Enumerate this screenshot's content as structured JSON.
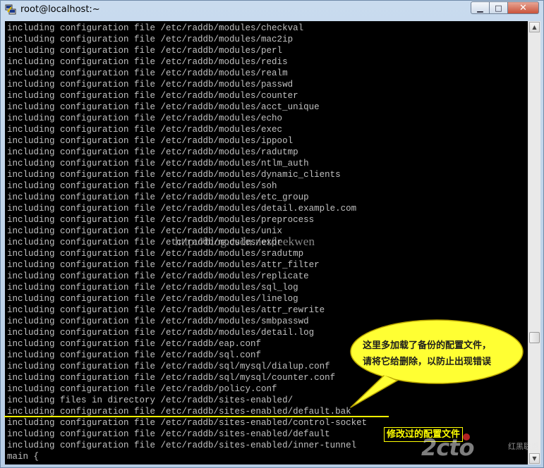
{
  "window": {
    "title": "root@localhost:~",
    "minimize_symbol": "▁",
    "maximize_symbol": "□",
    "close_symbol": "✕"
  },
  "terminal": {
    "lines": [
      "including configuration file /etc/raddb/modules/checkval",
      "including configuration file /etc/raddb/modules/mac2ip",
      "including configuration file /etc/raddb/modules/perl",
      "including configuration file /etc/raddb/modules/redis",
      "including configuration file /etc/raddb/modules/realm",
      "including configuration file /etc/raddb/modules/passwd",
      "including configuration file /etc/raddb/modules/counter",
      "including configuration file /etc/raddb/modules/acct_unique",
      "including configuration file /etc/raddb/modules/echo",
      "including configuration file /etc/raddb/modules/exec",
      "including configuration file /etc/raddb/modules/ippool",
      "including configuration file /etc/raddb/modules/radutmp",
      "including configuration file /etc/raddb/modules/ntlm_auth",
      "including configuration file /etc/raddb/modules/dynamic_clients",
      "including configuration file /etc/raddb/modules/soh",
      "including configuration file /etc/raddb/modules/etc_group",
      "including configuration file /etc/raddb/modules/detail.example.com",
      "including configuration file /etc/raddb/modules/preprocess",
      "including configuration file /etc/raddb/modules/unix",
      "including configuration file /etc/raddb/modules/expr",
      "including configuration file /etc/raddb/modules/sradutmp",
      "including configuration file /etc/raddb/modules/attr_filter",
      "including configuration file /etc/raddb/modules/replicate",
      "including configuration file /etc/raddb/modules/sql_log",
      "including configuration file /etc/raddb/modules/linelog",
      "including configuration file /etc/raddb/modules/attr_rewrite",
      "including configuration file /etc/raddb/modules/smbpasswd",
      "including configuration file /etc/raddb/modules/detail.log",
      "including configuration file /etc/raddb/eap.conf",
      "including configuration file /etc/raddb/sql.conf",
      "including configuration file /etc/raddb/sql/mysql/dialup.conf",
      "including configuration file /etc/raddb/sql/mysql/counter.conf",
      "including configuration file /etc/raddb/policy.conf",
      "including files in directory /etc/raddb/sites-enabled/",
      "including configuration file /etc/raddb/sites-enabled/default.bak",
      "including configuration file /etc/raddb/sites-enabled/control-socket",
      "including configuration file /etc/raddb/sites-enabled/default",
      "including configuration file /etc/raddb/sites-enabled/inner-tunnel",
      "main {"
    ]
  },
  "annotations": {
    "watermark": "http://blog.csdn.net/leekwen",
    "callout_line1": "这里多加载了备份的配置文件，",
    "callout_line2": "请将它给删除，以防止出现错误",
    "modified_tag": "修改过的配置文件",
    "logo_text": "2cto",
    "logo_sub": "红黑联盟",
    "callout_color": "#ffff33",
    "underline_color": "#ffff00"
  },
  "colors": {
    "terminal_bg": "#000000",
    "terminal_fg": "#c0c0c0",
    "titlebar": "#c9dbee"
  }
}
